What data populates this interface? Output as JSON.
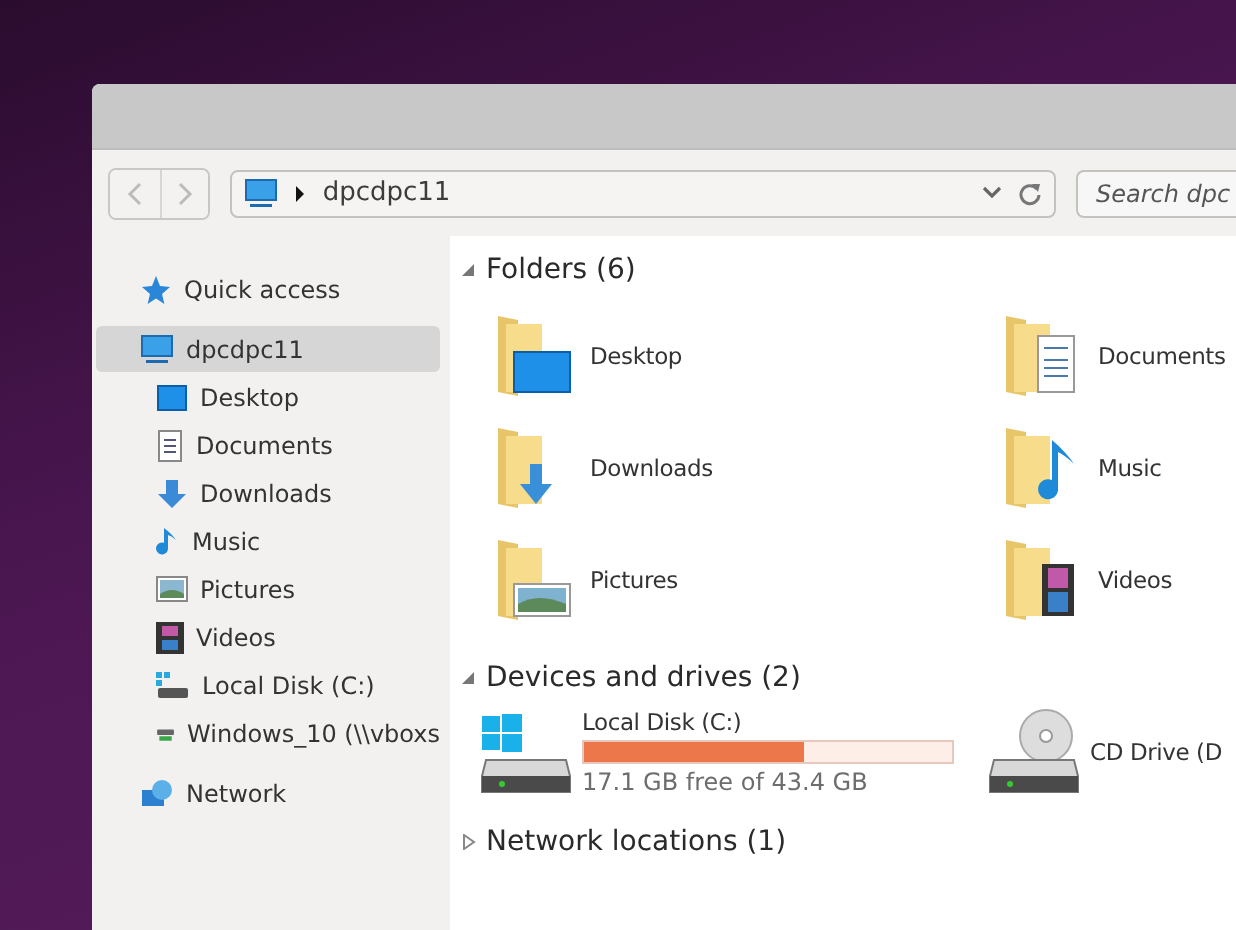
{
  "toolbar": {
    "address": "dpcdpc11",
    "search": {
      "placeholder": "Search dpc"
    }
  },
  "sidebar": {
    "items": [
      {
        "label": "Quick access",
        "selected": false
      },
      {
        "label": "dpcdpc11",
        "selected": true,
        "children": [
          {
            "label": "Desktop",
            "selected": false
          },
          {
            "label": "Documents",
            "selected": false
          },
          {
            "label": "Downloads",
            "selected": false
          },
          {
            "label": "Music",
            "selected": false
          },
          {
            "label": "Pictures",
            "selected": false
          },
          {
            "label": "Videos",
            "selected": false
          },
          {
            "label": "Local Disk (C:)",
            "selected": false
          },
          {
            "label": "Windows_10 (\\\\vboxs",
            "selected": false
          }
        ]
      },
      {
        "label": "Network",
        "selected": false
      }
    ]
  },
  "sections": [
    {
      "title": "Folders (6)",
      "expanded": true,
      "kind": "folders",
      "items": [
        {
          "label": "Desktop"
        },
        {
          "label": "Documents"
        },
        {
          "label": "Downloads"
        },
        {
          "label": "Music"
        },
        {
          "label": "Pictures"
        },
        {
          "label": "Videos"
        }
      ]
    },
    {
      "title": "Devices and drives (2)",
      "expanded": true,
      "kind": "drives",
      "items": [
        {
          "label": "Local Disk (C:)",
          "level": 0.6,
          "free": "17.1 GB free of 43.4 GB"
        },
        {
          "label": "CD Drive (D"
        }
      ]
    },
    {
      "title": "Network locations (1)",
      "expanded": false
    }
  ]
}
